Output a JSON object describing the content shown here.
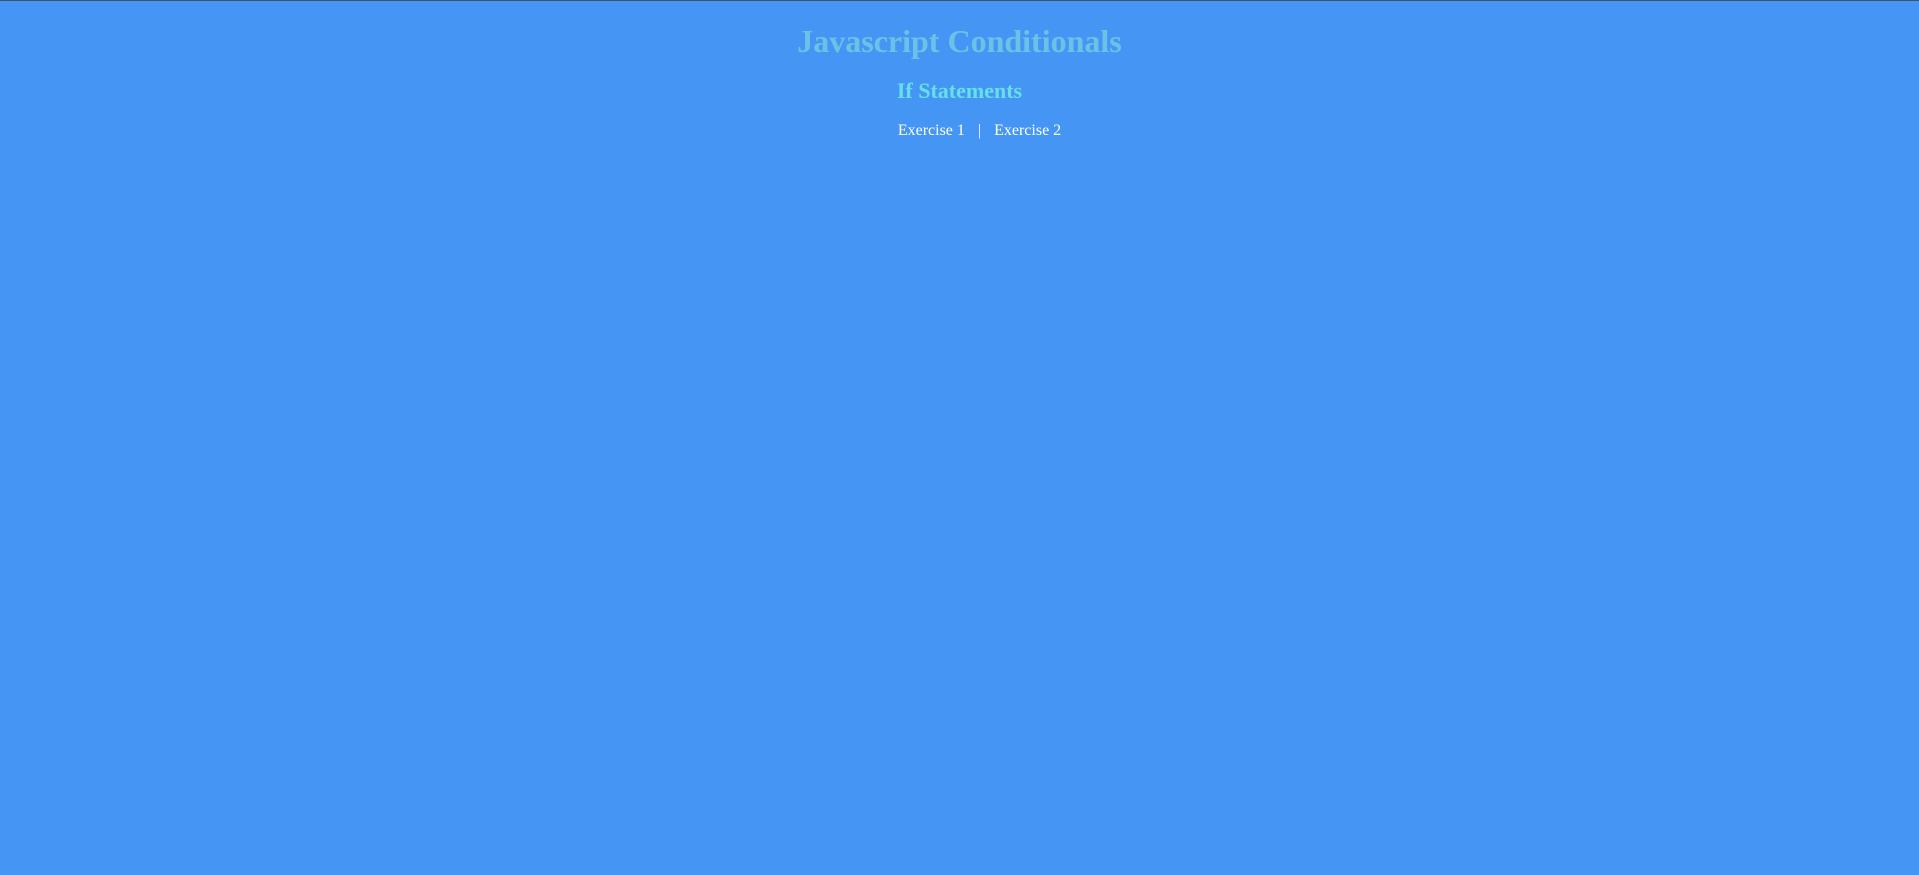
{
  "header": {
    "title": "Javascript Conditionals",
    "subtitle": "If Statements"
  },
  "nav": {
    "links": [
      {
        "label": "Exercise 1"
      },
      {
        "label": "Exercise 2"
      }
    ],
    "separator": "|"
  },
  "colors": {
    "background": "#4596f4",
    "title": "#6cc2e6",
    "subtitle": "#66e0e6",
    "link": "#ffffff"
  }
}
